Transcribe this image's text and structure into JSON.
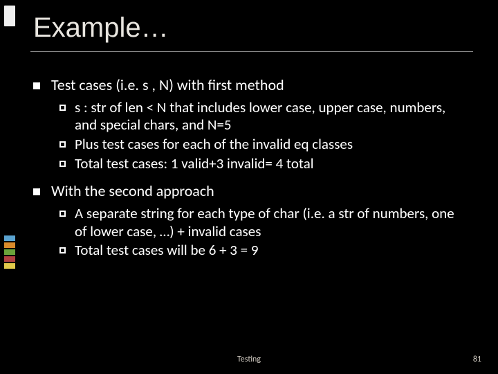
{
  "title": "Example…",
  "bullets": {
    "b1": "Test cases (i.e. s , N) with first method",
    "b1_subs": {
      "s1": "s : str of len < N that includes lower case, upper case, numbers, and special chars, and N=5",
      "s2": "Plus test cases for each of the invalid eq classes",
      "s3": "Total test cases: 1 valid+3 invalid= 4 total"
    },
    "b2": "With the second approach",
    "b2_subs": {
      "s1": "A separate string for each type of char (i.e. a str of numbers, one of lower case, …) + invalid cases",
      "s2": "Total test cases will be 6 + 3 = 9"
    }
  },
  "footer": {
    "center": "Testing",
    "page": "81"
  },
  "accent_colors": {
    "c1": "#5aa3d0",
    "c2": "#d98a2b",
    "c3": "#6aa33a",
    "c4": "#b04040",
    "c5": "#e2c94a"
  }
}
